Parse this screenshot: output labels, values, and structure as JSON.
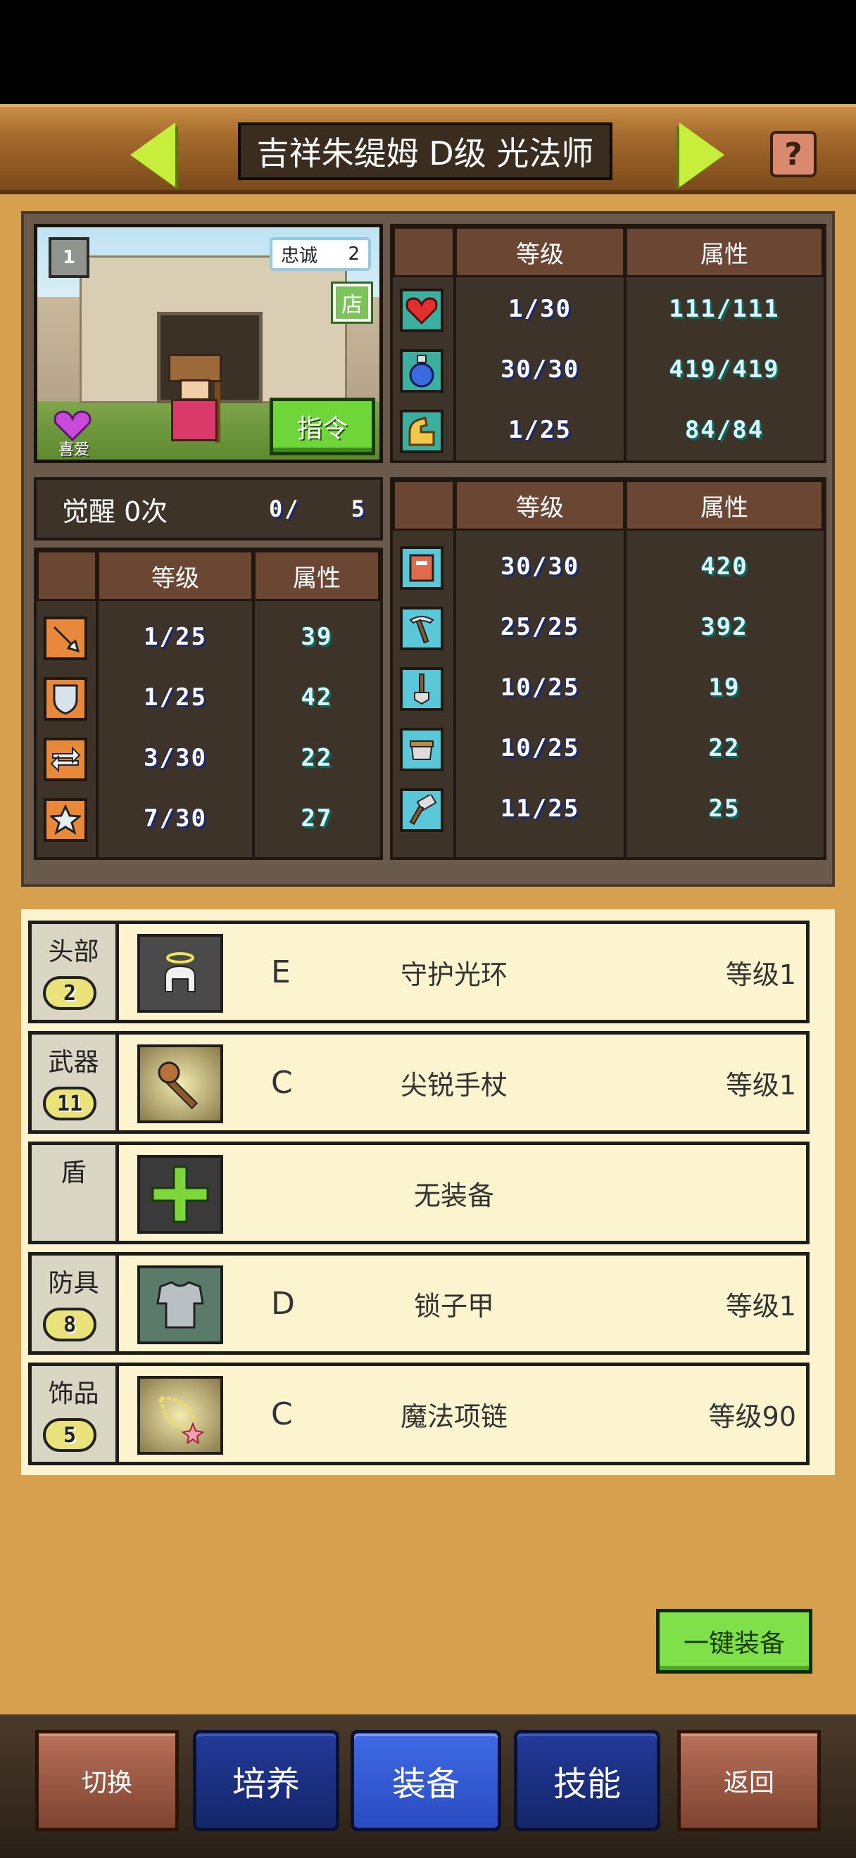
{
  "header": {
    "title": "吉祥朱缇姆 D级 光法师",
    "help_label": "?"
  },
  "portrait": {
    "card_rank": "1",
    "loyalty_label": "忠诚",
    "loyalty_value": "2",
    "shop_label": "店",
    "like_label": "喜爱",
    "command_label": "指令"
  },
  "awakening": {
    "label": "觉醒 0次",
    "progress": "0/",
    "max": "5"
  },
  "table_headers": {
    "level": "等级",
    "attribute": "属性"
  },
  "vitals": [
    {
      "icon": "heart-icon",
      "level": "1/30",
      "value": "111/111"
    },
    {
      "icon": "potion-icon",
      "level": "30/30",
      "value": "419/419"
    },
    {
      "icon": "strength-arm-icon",
      "level": "1/25",
      "value": "84/84"
    }
  ],
  "combat_stats": [
    {
      "icon": "sword-icon",
      "level": "1/25",
      "value": "39"
    },
    {
      "icon": "shield-icon",
      "level": "1/25",
      "value": "42"
    },
    {
      "icon": "speed-arrows-icon",
      "level": "3/30",
      "value": "22"
    },
    {
      "icon": "star-icon",
      "level": "7/30",
      "value": "27"
    }
  ],
  "work_stats": [
    {
      "icon": "book-icon",
      "level": "30/30",
      "value": "420"
    },
    {
      "icon": "pickaxe-icon",
      "level": "25/25",
      "value": "392"
    },
    {
      "icon": "shovel-icon",
      "level": "10/25",
      "value": "19"
    },
    {
      "icon": "pot-icon",
      "level": "10/25",
      "value": "22"
    },
    {
      "icon": "hammer-icon",
      "level": "11/25",
      "value": "25"
    }
  ],
  "equipment": [
    {
      "slot": "头部",
      "slot_num": "2",
      "icon": "halo-icon",
      "rank": "E",
      "name": "守护光环",
      "level": "等级1"
    },
    {
      "slot": "武器",
      "slot_num": "11",
      "icon": "staff-icon",
      "rank": "C",
      "name": "尖锐手杖",
      "level": "等级1"
    },
    {
      "slot": "盾",
      "slot_num": "",
      "icon": "plus-icon",
      "rank": "",
      "name": "无装备",
      "level": ""
    },
    {
      "slot": "防具",
      "slot_num": "8",
      "icon": "chainmail-icon",
      "rank": "D",
      "name": "锁子甲",
      "level": "等级1"
    },
    {
      "slot": "饰品",
      "slot_num": "5",
      "icon": "necklace-icon",
      "rank": "C",
      "name": "魔法项链",
      "level": "等级90"
    }
  ],
  "auto_equip_label": "一键装备",
  "nav": {
    "switch": "切换",
    "train": "培养",
    "equip": "装备",
    "skill": "技能",
    "back": "返回"
  },
  "colors": {
    "accent_green": "#7fe04a",
    "panel_bg": "#d6a04e",
    "active_tab": "#3f6ae6"
  }
}
